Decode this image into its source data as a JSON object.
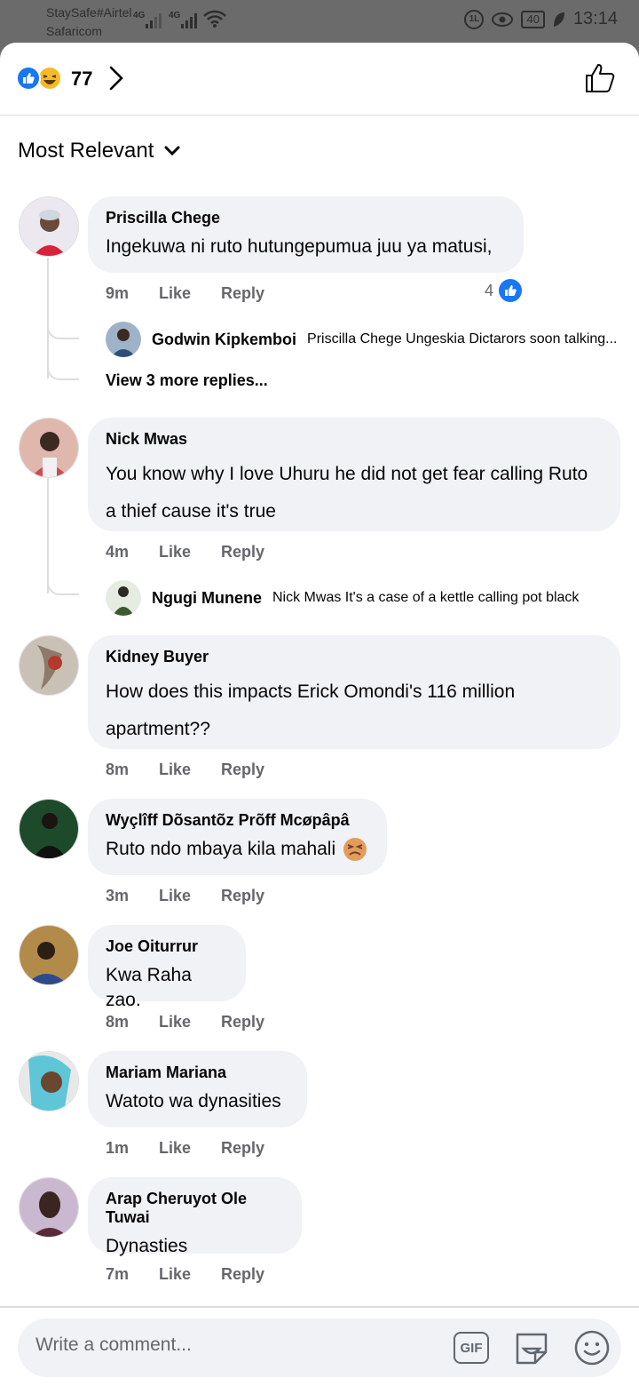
{
  "status_bar": {
    "carrier1": "StaySafe#Airtel",
    "carrier2": "Safaricom",
    "net1": "4G",
    "net2": "4G",
    "battery": "40",
    "time": "13:14"
  },
  "header": {
    "reaction_count": "77"
  },
  "sort": {
    "label": "Most Relevant"
  },
  "comments": [
    {
      "author": "Priscilla Chege",
      "text": "Ingekuwa ni ruto hutungepumua juu ya matusi,",
      "time": "9m",
      "like": "Like",
      "reply": "Reply",
      "likes": "4",
      "replies": [
        {
          "author": "Godwin Kipkemboi",
          "text": "Priscilla Chege Ungeskia Dictarors soon talking..."
        }
      ],
      "more_replies": "View 3 more replies..."
    },
    {
      "author": "Nick Mwas",
      "text_line1": "You know why I love Uhuru he did not get fear calling Ruto",
      "text_line2": "a thief cause it's true",
      "time": "4m",
      "like": "Like",
      "reply": "Reply",
      "replies": [
        {
          "author": "Ngugi Munene",
          "text": "Nick Mwas It's a case of a kettle calling pot black"
        }
      ]
    },
    {
      "author": "Kidney Buyer",
      "text_line1": "How does this impacts Erick Omondi's 116 million",
      "text_line2": "apartment??",
      "time": "8m",
      "like": "Like",
      "reply": "Reply"
    },
    {
      "author": "Wyçlîff Dõsantõz Prõff Mcøpâpâ",
      "text": "Ruto ndo mbaya kila mahali",
      "time": "3m",
      "like": "Like",
      "reply": "Reply"
    },
    {
      "author": "Joe Oiturrur",
      "text": "Kwa Raha zao.",
      "time": "8m",
      "like": "Like",
      "reply": "Reply"
    },
    {
      "author": "Mariam Mariana",
      "text": "Watoto wa dynasities",
      "time": "1m",
      "like": "Like",
      "reply": "Reply"
    },
    {
      "author": "Arap Cheruyot Ole Tuwai",
      "text": "Dynasties",
      "time": "7m",
      "like": "Like",
      "reply": "Reply"
    }
  ],
  "composer": {
    "placeholder": "Write a comment...",
    "gif_label": "GIF"
  },
  "colors": {
    "accent": "#1877f2",
    "bubble": "#f0f2f5",
    "secondary_text": "#65676b"
  }
}
